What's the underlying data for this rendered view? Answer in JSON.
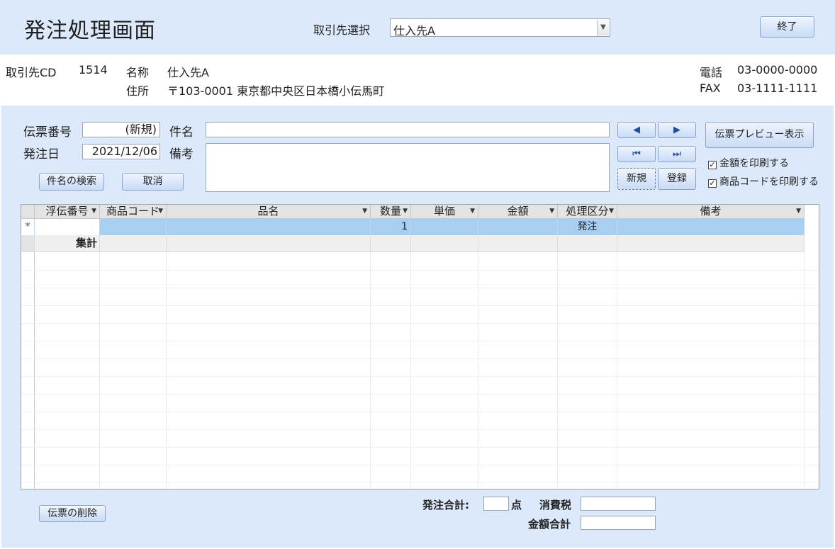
{
  "header": {
    "title": "発注処理画面",
    "supplier_select_label": "取引先選択",
    "supplier_select_value": "仕入先A",
    "exit_label": "終了"
  },
  "supplier": {
    "cd_label": "取引先CD",
    "cd_value": "1514",
    "name_label": "名称",
    "name_value": "仕入先A",
    "address_label": "住所",
    "address_value": "〒103-0001 東京都中央区日本橋小伝馬町",
    "phone_label": "電話",
    "phone_value": "03-0000-0000",
    "fax_label": "FAX",
    "fax_value": "03-1111-1111"
  },
  "form": {
    "voucher_no_label": "伝票番号",
    "voucher_no_value": "(新規)",
    "subject_label": "件名",
    "subject_value": "",
    "order_date_label": "発注日",
    "order_date_value": "2021/12/06",
    "remarks_label": "備考",
    "remarks_value": "",
    "search_subject_label": "件名の検索",
    "cancel_label": "取消",
    "new_label": "新規",
    "register_label": "登録",
    "preview_label": "伝票プレビュー表示",
    "print_amount_label": "金額を印刷する",
    "print_amount_checked": true,
    "print_code_label": "商品コードを印刷する",
    "print_code_checked": true
  },
  "nav": {
    "prev_icon": "◀",
    "next_icon": "▶",
    "first_icon": "⏮",
    "last_icon": "⏭"
  },
  "grid": {
    "columns": [
      "浮伝番号",
      "商品コード",
      "品名",
      "数量",
      "単価",
      "金額",
      "処理区分",
      "備考"
    ],
    "new_row": {
      "marker": "*",
      "quantity": "1",
      "category": "発注"
    },
    "summary_label": "集計"
  },
  "footer": {
    "delete_label": "伝票の削除",
    "order_total_label": "発注合計:",
    "points_unit": "点",
    "tax_label": "消費税",
    "amount_total_label": "金額合計",
    "order_total_value": "",
    "tax_value": "",
    "amount_total_value": ""
  }
}
